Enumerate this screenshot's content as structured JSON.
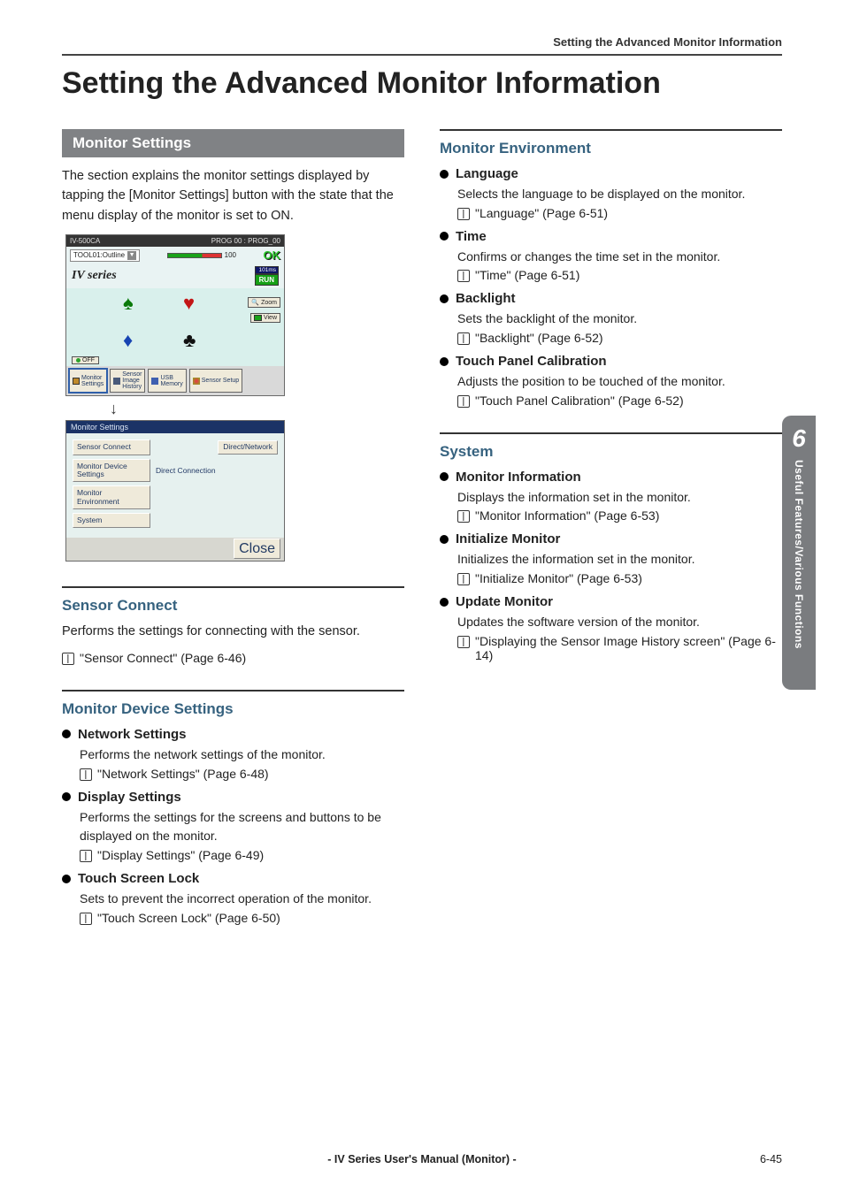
{
  "header": {
    "breadcrumb": "Setting the Advanced Monitor Information"
  },
  "title": "Setting the Advanced Monitor Information",
  "monitor_settings": {
    "bar": "Monitor Settings",
    "intro": "The section explains the monitor settings displayed by tapping the [Monitor Settings] button with the state that the menu display of the monitor is set to ON."
  },
  "device_top": {
    "model": "IV-500CA",
    "prog": "PROG 00 : PROG_00",
    "tool_label": "TOOL01:Outline",
    "score": "100",
    "ok": "OK",
    "ms": "101ms",
    "brand": "IV series",
    "run": "RUN",
    "zoom": "Zoom",
    "view": "View",
    "off": "OFF",
    "tabs": {
      "monitor": "Monitor\nSettings",
      "history": "Sensor\nImage\nHistory",
      "usb": "USB\nMemory",
      "setup": "Sensor Setup"
    }
  },
  "device_panel": {
    "title": "Monitor Settings",
    "rows": {
      "sensor_connect": "Sensor Connect",
      "direct_network": "Direct/Network",
      "device_settings": "Monitor Device\nSettings",
      "direct_connection": "Direct Connection",
      "monitor_env": "Monitor\nEnvironment",
      "system": "System"
    },
    "close": "Close"
  },
  "sensor_connect": {
    "title": "Sensor Connect",
    "text": "Performs the settings for connecting with the sensor.",
    "ref": "\"Sensor Connect\" (Page 6-46)"
  },
  "device_settings": {
    "title": "Monitor Device Settings",
    "items": [
      {
        "head": "Network Settings",
        "desc": "Performs the network settings of the monitor.",
        "ref": "\"Network Settings\" (Page 6-48)"
      },
      {
        "head": "Display Settings",
        "desc": "Performs the settings for the screens and buttons to be displayed on the monitor.",
        "ref": "\"Display Settings\" (Page 6-49)"
      },
      {
        "head": "Touch Screen Lock",
        "desc": "Sets to prevent the incorrect operation of the monitor.",
        "ref": "\"Touch Screen Lock\" (Page 6-50)"
      }
    ]
  },
  "monitor_env": {
    "title": "Monitor Environment",
    "items": [
      {
        "head": "Language",
        "desc": "Selects the language to be displayed on the monitor.",
        "ref": "\"Language\" (Page 6-51)"
      },
      {
        "head": "Time",
        "desc": "Confirms or changes the time set in the monitor.",
        "ref": "\"Time\" (Page 6-51)"
      },
      {
        "head": "Backlight",
        "desc": "Sets the backlight of the monitor.",
        "ref": "\"Backlight\" (Page 6-52)"
      },
      {
        "head": "Touch Panel Calibration",
        "desc": "Adjusts the position to be touched of the monitor.",
        "ref": "\"Touch Panel Calibration\" (Page 6-52)"
      }
    ]
  },
  "system": {
    "title": "System",
    "items": [
      {
        "head": "Monitor Information",
        "desc": "Displays the information set in the monitor.",
        "ref": "\"Monitor Information\" (Page 6-53)"
      },
      {
        "head": "Initialize Monitor",
        "desc": "Initializes the information set in the monitor.",
        "ref": "\"Initialize Monitor\" (Page 6-53)"
      },
      {
        "head": "Update Monitor",
        "desc": "Updates the software version of the monitor.",
        "ref": "\"Displaying the Sensor Image History screen\" (Page 6-14)"
      }
    ]
  },
  "side_tab": {
    "num": "6",
    "text": "Useful Features/Various Functions"
  },
  "footer": {
    "center": "- IV Series User's Manual (Monitor) -",
    "page": "6-45"
  }
}
